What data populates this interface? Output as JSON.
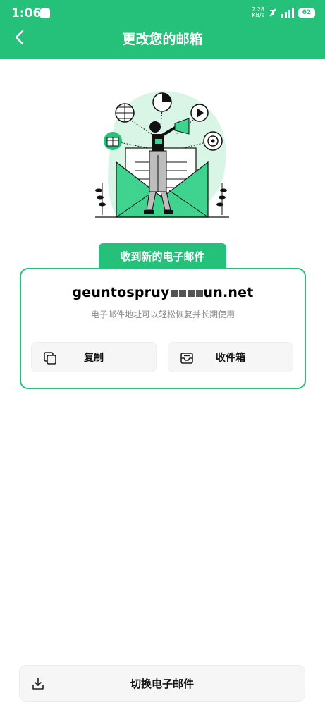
{
  "status_bar": {
    "time": "1:06",
    "net_speed_value": "2.28",
    "net_speed_unit": "KB/s",
    "battery": "62"
  },
  "header": {
    "title": "更改您的邮箱"
  },
  "card": {
    "tag": "收到新的电子邮件",
    "email_part1": "geuntospruy",
    "email_part2": "un.net",
    "hint": "电子邮件地址可以轻松恢复并长期使用",
    "copy_label": "复制",
    "inbox_label": "收件箱"
  },
  "footer": {
    "switch_label": "切换电子邮件"
  },
  "icons": {
    "back": "chevron-left-icon",
    "copy": "copy-icon",
    "inbox": "inbox-icon",
    "switch": "download-icon"
  },
  "colors": {
    "accent": "#25c07a",
    "accent_light": "#d8f5e6"
  }
}
